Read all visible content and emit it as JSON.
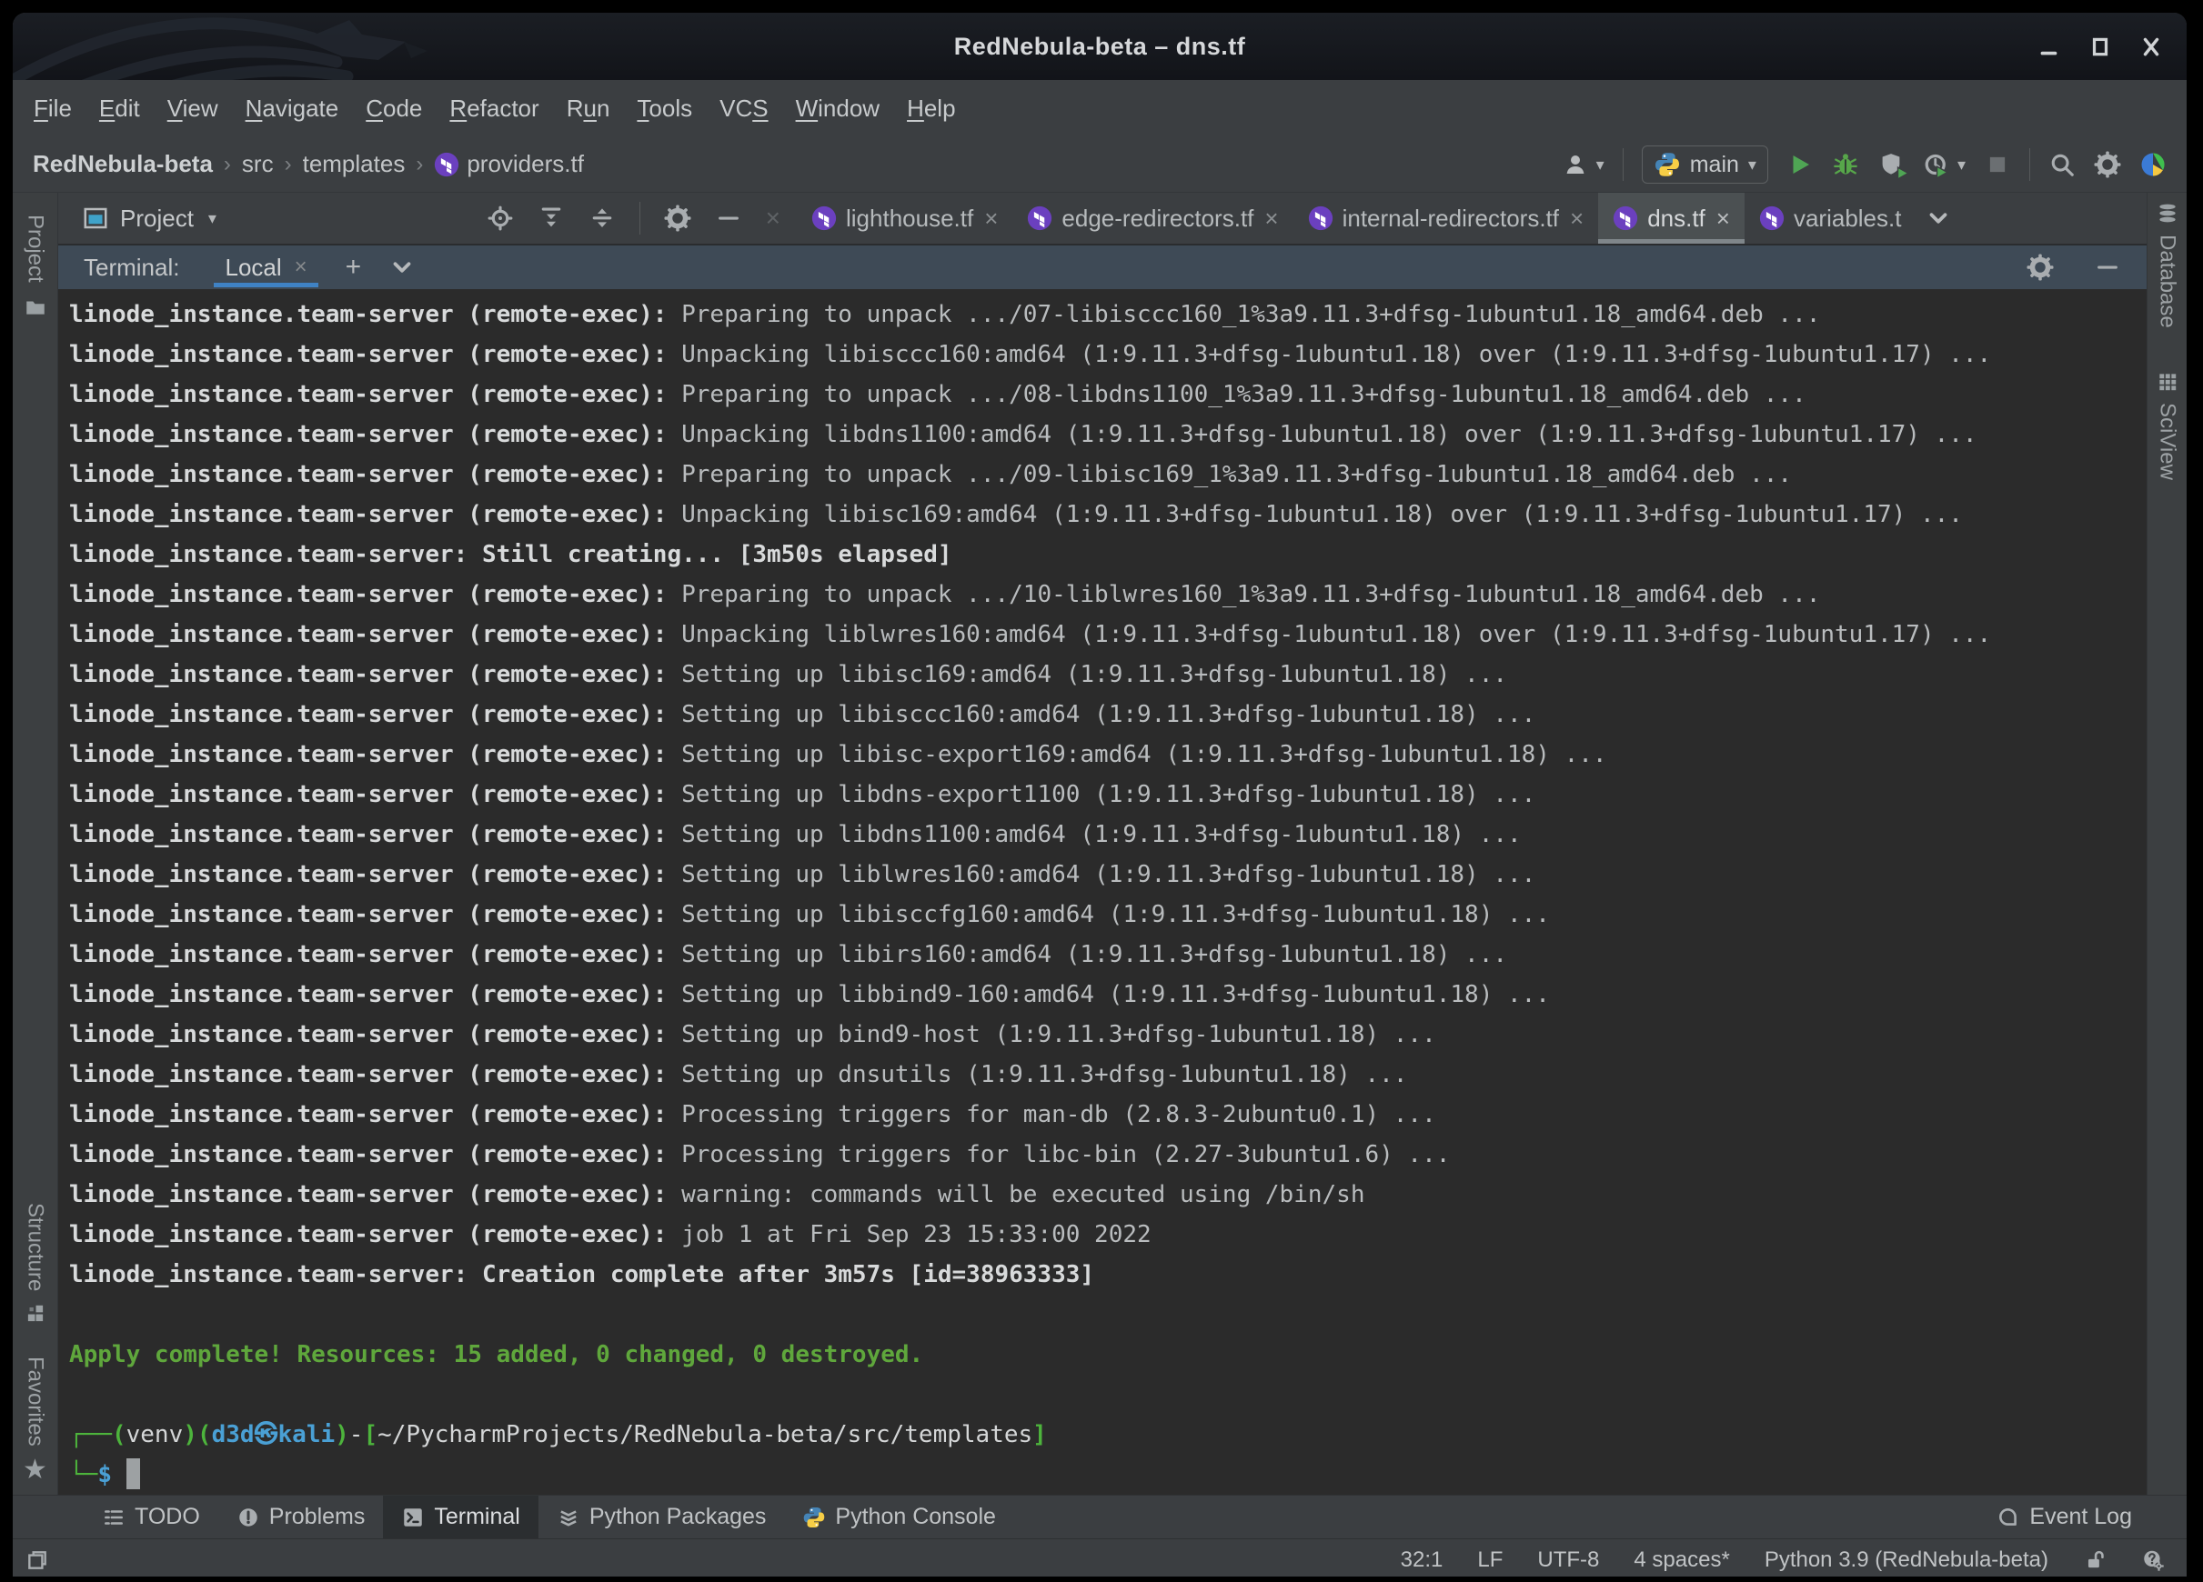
{
  "window": {
    "title": "RedNebula-beta – dns.tf"
  },
  "menubar": {
    "items": [
      {
        "label": "File",
        "u": 0
      },
      {
        "label": "Edit",
        "u": 0
      },
      {
        "label": "View",
        "u": 0
      },
      {
        "label": "Navigate",
        "u": 0
      },
      {
        "label": "Code",
        "u": 0
      },
      {
        "label": "Refactor",
        "u": 0
      },
      {
        "label": "Run",
        "u": 1
      },
      {
        "label": "Tools",
        "u": 0
      },
      {
        "label": "VCS",
        "u": 2
      },
      {
        "label": "Window",
        "u": 0
      },
      {
        "label": "Help",
        "u": 0
      }
    ]
  },
  "breadcrumbs": {
    "root": "RedNebula-beta",
    "path": [
      "src",
      "templates"
    ],
    "file": "providers.tf",
    "separator": "›"
  },
  "run_widget": {
    "config": "main"
  },
  "project_panel": {
    "title": "Project"
  },
  "editor_tabs": {
    "tabs": [
      {
        "label": "lighthouse.tf"
      },
      {
        "label": "edge-redirectors.tf"
      },
      {
        "label": "internal-redirectors.tf"
      },
      {
        "label": "dns.tf",
        "active": true
      },
      {
        "label": "variables.t"
      }
    ]
  },
  "ui_glyphs": {
    "close": "×",
    "plus": "+",
    "dropdown": "▾",
    "star": "★"
  },
  "left_stripe": {
    "top": "Project",
    "middle": "Structure",
    "bottom": "Favorites"
  },
  "right_stripe": {
    "top": "Database",
    "bottom": "SciView"
  },
  "terminal_panel": {
    "label": "Terminal:",
    "tab": "Local",
    "lines": [
      [
        [
          "b",
          "linode_instance.team-server (remote-exec):"
        ],
        [
          "p",
          " Preparing to unpack .../07-libisccc160_1%3a9.11.3+dfsg-1ubuntu1.18_amd64.deb ..."
        ]
      ],
      [
        [
          "b",
          "linode_instance.team-server (remote-exec):"
        ],
        [
          "p",
          " Unpacking libisccc160:amd64 (1:9.11.3+dfsg-1ubuntu1.18) over (1:9.11.3+dfsg-1ubuntu1.17) ..."
        ]
      ],
      [
        [
          "b",
          "linode_instance.team-server (remote-exec):"
        ],
        [
          "p",
          " Preparing to unpack .../08-libdns1100_1%3a9.11.3+dfsg-1ubuntu1.18_amd64.deb ..."
        ]
      ],
      [
        [
          "b",
          "linode_instance.team-server (remote-exec):"
        ],
        [
          "p",
          " Unpacking libdns1100:amd64 (1:9.11.3+dfsg-1ubuntu1.18) over (1:9.11.3+dfsg-1ubuntu1.17) ..."
        ]
      ],
      [
        [
          "b",
          "linode_instance.team-server (remote-exec):"
        ],
        [
          "p",
          " Preparing to unpack .../09-libisc169_1%3a9.11.3+dfsg-1ubuntu1.18_amd64.deb ..."
        ]
      ],
      [
        [
          "b",
          "linode_instance.team-server (remote-exec):"
        ],
        [
          "p",
          " Unpacking libisc169:amd64 (1:9.11.3+dfsg-1ubuntu1.18) over (1:9.11.3+dfsg-1ubuntu1.17) ..."
        ]
      ],
      [
        [
          "b",
          "linode_instance.team-server: Still creating... [3m50s elapsed]"
        ]
      ],
      [
        [
          "b",
          "linode_instance.team-server (remote-exec):"
        ],
        [
          "p",
          " Preparing to unpack .../10-liblwres160_1%3a9.11.3+dfsg-1ubuntu1.18_amd64.deb ..."
        ]
      ],
      [
        [
          "b",
          "linode_instance.team-server (remote-exec):"
        ],
        [
          "p",
          " Unpacking liblwres160:amd64 (1:9.11.3+dfsg-1ubuntu1.18) over (1:9.11.3+dfsg-1ubuntu1.17) ..."
        ]
      ],
      [
        [
          "b",
          "linode_instance.team-server (remote-exec):"
        ],
        [
          "p",
          " Setting up libisc169:amd64 (1:9.11.3+dfsg-1ubuntu1.18) ..."
        ]
      ],
      [
        [
          "b",
          "linode_instance.team-server (remote-exec):"
        ],
        [
          "p",
          " Setting up libisccc160:amd64 (1:9.11.3+dfsg-1ubuntu1.18) ..."
        ]
      ],
      [
        [
          "b",
          "linode_instance.team-server (remote-exec):"
        ],
        [
          "p",
          " Setting up libisc-export169:amd64 (1:9.11.3+dfsg-1ubuntu1.18) ..."
        ]
      ],
      [
        [
          "b",
          "linode_instance.team-server (remote-exec):"
        ],
        [
          "p",
          " Setting up libdns-export1100 (1:9.11.3+dfsg-1ubuntu1.18) ..."
        ]
      ],
      [
        [
          "b",
          "linode_instance.team-server (remote-exec):"
        ],
        [
          "p",
          " Setting up libdns1100:amd64 (1:9.11.3+dfsg-1ubuntu1.18) ..."
        ]
      ],
      [
        [
          "b",
          "linode_instance.team-server (remote-exec):"
        ],
        [
          "p",
          " Setting up liblwres160:amd64 (1:9.11.3+dfsg-1ubuntu1.18) ..."
        ]
      ],
      [
        [
          "b",
          "linode_instance.team-server (remote-exec):"
        ],
        [
          "p",
          " Setting up libisccfg160:amd64 (1:9.11.3+dfsg-1ubuntu1.18) ..."
        ]
      ],
      [
        [
          "b",
          "linode_instance.team-server (remote-exec):"
        ],
        [
          "p",
          " Setting up libirs160:amd64 (1:9.11.3+dfsg-1ubuntu1.18) ..."
        ]
      ],
      [
        [
          "b",
          "linode_instance.team-server (remote-exec):"
        ],
        [
          "p",
          " Setting up libbind9-160:amd64 (1:9.11.3+dfsg-1ubuntu1.18) ..."
        ]
      ],
      [
        [
          "b",
          "linode_instance.team-server (remote-exec):"
        ],
        [
          "p",
          " Setting up bind9-host (1:9.11.3+dfsg-1ubuntu1.18) ..."
        ]
      ],
      [
        [
          "b",
          "linode_instance.team-server (remote-exec):"
        ],
        [
          "p",
          " Setting up dnsutils (1:9.11.3+dfsg-1ubuntu1.18) ..."
        ]
      ],
      [
        [
          "b",
          "linode_instance.team-server (remote-exec):"
        ],
        [
          "p",
          " Processing triggers for man-db (2.8.3-2ubuntu0.1) ..."
        ]
      ],
      [
        [
          "b",
          "linode_instance.team-server (remote-exec):"
        ],
        [
          "p",
          " Processing triggers for libc-bin (2.27-3ubuntu1.6) ..."
        ]
      ],
      [
        [
          "b",
          "linode_instance.team-server (remote-exec):"
        ],
        [
          "p",
          " warning: commands will be executed using /bin/sh"
        ]
      ],
      [
        [
          "b",
          "linode_instance.team-server (remote-exec):"
        ],
        [
          "p",
          " job 1 at Fri Sep 23 15:33:00 2022"
        ]
      ],
      [
        [
          "b",
          "linode_instance.team-server: Creation complete after 3m57s [id=38963333]"
        ]
      ],
      [],
      [
        [
          "g",
          "Apply complete! Resources: 15 added, 0 changed, 0 destroyed."
        ]
      ],
      [],
      [
        [
          "kg",
          "┌──("
        ],
        [
          "w",
          "venv"
        ],
        [
          "kg",
          ")("
        ],
        [
          "kb",
          "d3d㉿kali"
        ],
        [
          "kg",
          ")"
        ],
        [
          "w",
          "-"
        ],
        [
          "kg",
          "["
        ],
        [
          "w",
          "~/PycharmProjects/RedNebula-beta/src/templates"
        ],
        [
          "kg",
          "]"
        ]
      ],
      [
        [
          "kg",
          "└─"
        ],
        [
          "kb",
          "$"
        ],
        [
          "w",
          " "
        ],
        [
          "cursor",
          ""
        ]
      ]
    ]
  },
  "bottom_bar": {
    "items": [
      {
        "label": "TODO"
      },
      {
        "label": "Problems"
      },
      {
        "label": "Terminal",
        "active": true
      },
      {
        "label": "Python Packages"
      },
      {
        "label": "Python Console"
      }
    ],
    "right_label": "Event Log"
  },
  "status_bar": {
    "caret": "32:1",
    "line_separator": "LF",
    "encoding": "UTF-8",
    "indent": "4 spaces*",
    "interpreter": "Python 3.9 (RedNebula-beta)"
  },
  "colors": {
    "chrome": "#3b3e41",
    "terminal_bg": "#2b2b2b",
    "titlebar": "#16181d",
    "terraform_purple": "#6b40bf",
    "run_green": "#4fa554",
    "apply_green": "#5fa73c",
    "prompt_green": "#4db43c",
    "prompt_blue": "#4aa0d5",
    "tab_underline_blue": "#3f82c4"
  }
}
